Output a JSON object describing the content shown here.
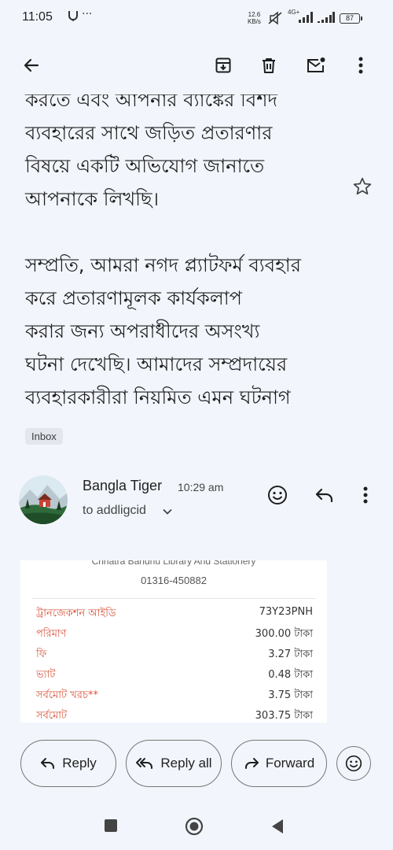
{
  "status_bar": {
    "time": "11:05",
    "speed_value": "12.6",
    "speed_unit": "KB/s",
    "network": "4G+",
    "battery": "87"
  },
  "email": {
    "paragraphs": [
      [
        "করতে এবং আপনার ব্যাঙ্কের বিশদ",
        "ব্যবহারের সাথে জড়িত প্রতারণার",
        "বিষয়ে একটি অভিযোগ জানাতে",
        "আপনাকে লিখছি।"
      ],
      [
        "সম্প্রতি, আমরা নগদ প্ল্যাটফর্ম ব্যবহার",
        "করে প্রতারণামূলক কার্যকলাপ",
        "করার জন্য অপরাধীদের অসংখ্য",
        "ঘটনা দেখেছি। আমাদের সম্প্রদায়ের",
        "ব্যবহারকারীরা নিয়মিত এমন ঘটনাগ"
      ]
    ],
    "label_chip": "Inbox"
  },
  "sender": {
    "name": "Bangla Tiger",
    "time": "10:29 am",
    "recipient": "to addligcid"
  },
  "receipt": {
    "merchant": "Chhatra Bandhu Library And Stationery",
    "phone": "01316-450882",
    "rows": [
      {
        "label": "ট্রানজেকশন আইডি",
        "value": "73Y23PNH"
      },
      {
        "label": "পরিমাণ",
        "value": "300.00 টাকা"
      },
      {
        "label": "ফি",
        "value": "3.27 টাকা"
      },
      {
        "label": "ভ্যাট",
        "value": "0.48 টাকা"
      },
      {
        "label": "সর্বমোট খরচ**",
        "value": "3.75 টাকা"
      },
      {
        "label": "সর্বমোট",
        "value": "303.75 টাকা"
      }
    ]
  },
  "actions": {
    "reply": "Reply",
    "reply_all": "Reply all",
    "forward": "Forward"
  },
  "colors": {
    "background": "#f2f6fc",
    "receipt_label": "#d9533b"
  }
}
